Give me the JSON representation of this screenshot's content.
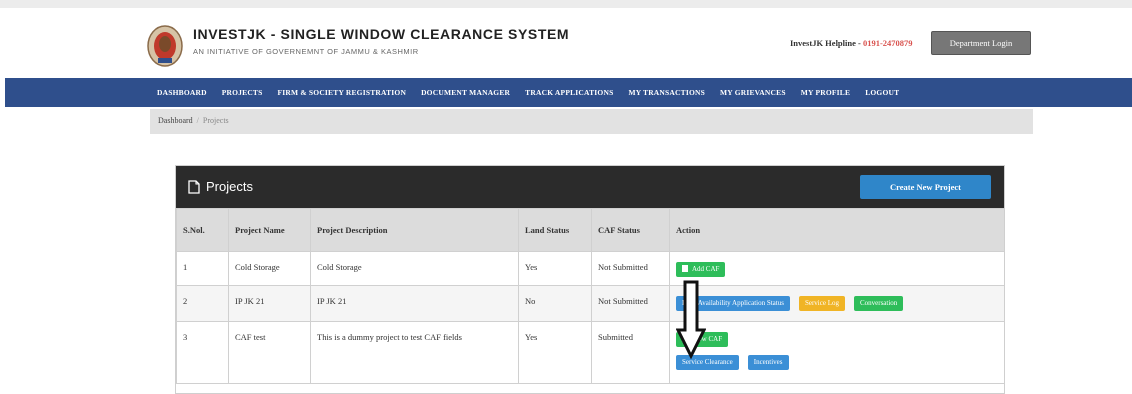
{
  "header": {
    "title": "INVESTJK - SINGLE WINDOW CLEARANCE SYSTEM",
    "subtitle": "AN INITIATIVE OF GOVERNEMNT OF JAMMU & KASHMIR",
    "helpline_label": "InvestJK Helpline - ",
    "helpline_number": "0191-2470879",
    "department_login": "Department Login"
  },
  "nav": {
    "items": [
      "DASHBOARD",
      "PROJECTS",
      "FIRM & SOCIETY REGISTRATION",
      "DOCUMENT MANAGER",
      "TRACK APPLICATIONS",
      "MY TRANSACTIONS",
      "MY GRIEVANCES",
      "MY PROFILE",
      "LOGOUT"
    ]
  },
  "breadcrumb": {
    "home": "Dashboard",
    "separator": "/",
    "current": "Projects"
  },
  "panel": {
    "title": "Projects",
    "create_button": "Create New Project"
  },
  "table": {
    "headers": [
      "S.Nol.",
      "Project Name",
      "Project Description",
      "Land Status",
      "CAF Status",
      "Action"
    ],
    "rows": [
      {
        "sno": "1",
        "name": "Cold Storage",
        "description": "Cold Storage",
        "land": "Yes",
        "caf": "Not Submitted",
        "actions": [
          "Add CAF"
        ]
      },
      {
        "sno": "2",
        "name": "IP JK 21",
        "description": "IP JK 21",
        "land": "No",
        "caf": "Not Submitted",
        "actions": [
          "Land Availability Application Status",
          "Service Log",
          "Conversation"
        ]
      },
      {
        "sno": "3",
        "name": "CAF test",
        "description": "This is a dummy project to test CAF fields",
        "land": "Yes",
        "caf": "Submitted",
        "actions": [
          "View CAF",
          "Service Clearance",
          "Incentives"
        ]
      }
    ]
  },
  "colors": {
    "nav": "#2f4f8c",
    "panel_head": "#2b2b2b",
    "green": "#2ebd5a",
    "blue": "#3b8fd6",
    "yellow": "#f0b425"
  }
}
